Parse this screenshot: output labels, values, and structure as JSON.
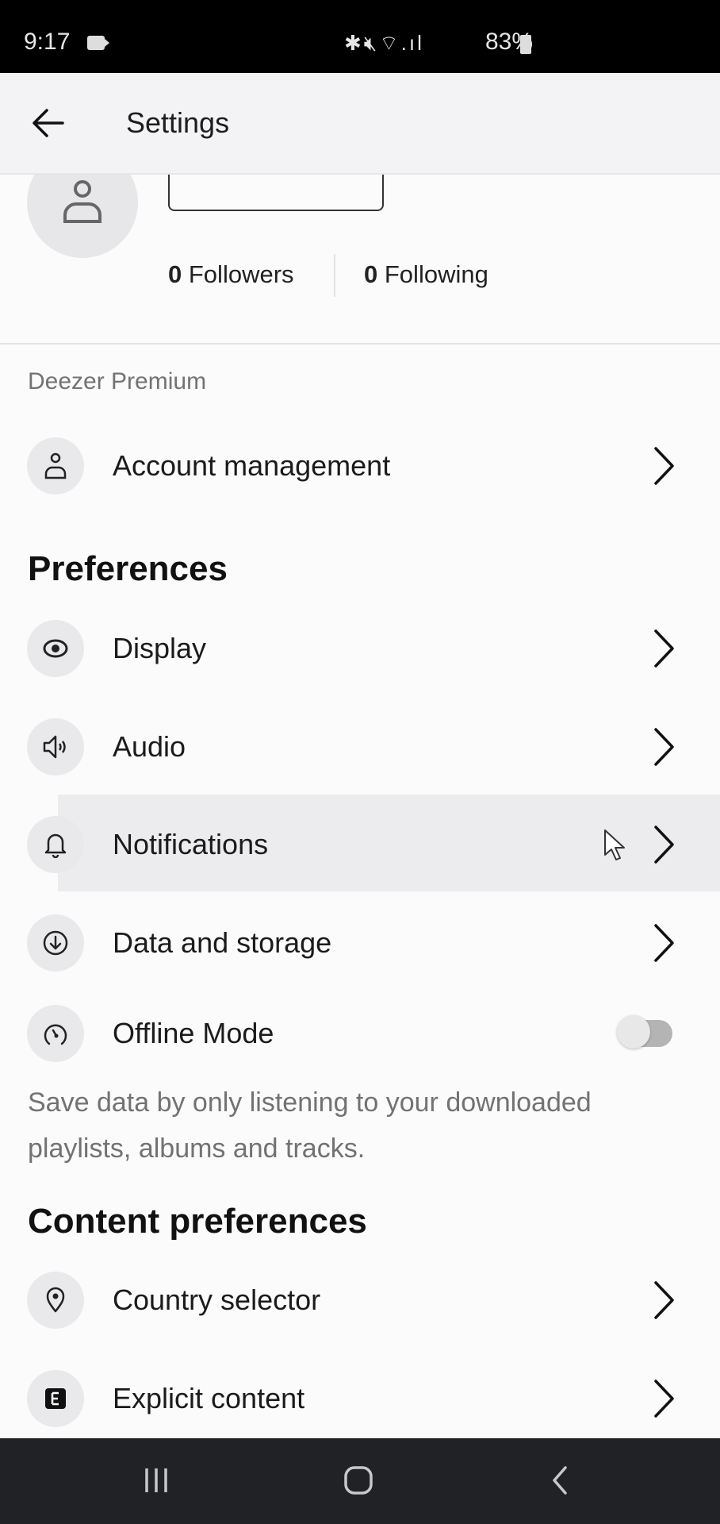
{
  "status_bar": {
    "time": "9:17",
    "icons": [
      "bluetooth-icon",
      "mute-icon",
      "wifi-icon",
      "signal-icon"
    ],
    "battery": "83%"
  },
  "header": {
    "title": "Settings",
    "back_icon": "arrow-left-icon"
  },
  "profile": {
    "followers_count": "0",
    "followers_label": "Followers",
    "following_count": "0",
    "following_label": "Following"
  },
  "premium": {
    "label": "Deezer Premium",
    "items": [
      {
        "label": "Account management",
        "icon": "user-icon"
      }
    ]
  },
  "preferences": {
    "heading": "Preferences",
    "items": [
      {
        "label": "Display",
        "icon": "eye-icon"
      },
      {
        "label": "Audio",
        "icon": "speaker-icon"
      },
      {
        "label": "Notifications",
        "icon": "bell-icon",
        "highlighted": true
      },
      {
        "label": "Data and storage",
        "icon": "download-circle-icon"
      }
    ],
    "offline": {
      "label": "Offline Mode",
      "icon": "gauge-icon",
      "enabled": false,
      "description": "Save data by only listening to your downloaded playlists, albums and tracks."
    }
  },
  "content_preferences": {
    "heading": "Content preferences",
    "items": [
      {
        "label": "Country selector",
        "icon": "location-pin-icon"
      },
      {
        "label": "Explicit content",
        "icon": "explicit-icon"
      }
    ]
  },
  "nav_bar": {
    "buttons": [
      "recent-apps-icon",
      "home-icon",
      "back-icon"
    ]
  }
}
